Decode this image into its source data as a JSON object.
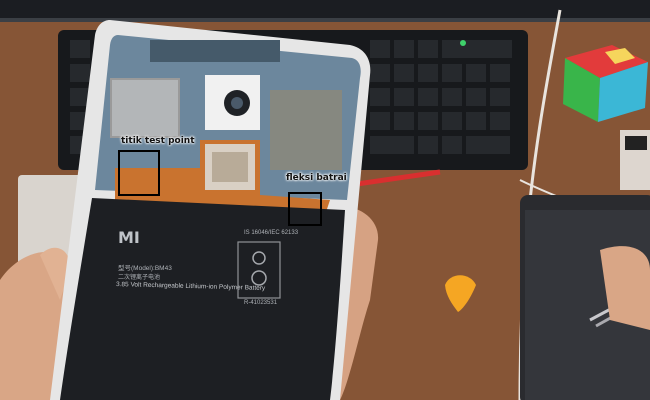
{
  "annotations": {
    "test_point_label": "titik test point",
    "battery_flex_label": "fleksi batrai"
  },
  "battery": {
    "brand": "MI",
    "model": "型号(Model):BM43",
    "cert": "IS 16046/IEC 62133",
    "reg": "R-41023531",
    "title_cn": "二次锂离子电池",
    "subtitle": "3.85 Volt Rechargeable Lithium-ion Polymer Battery"
  },
  "colors": {
    "desk": "#8a5a3a",
    "battery": "#1d1f23",
    "board": "#6f8aa0",
    "keyboard": "#1a1c1f",
    "flex": "#c9732f"
  }
}
